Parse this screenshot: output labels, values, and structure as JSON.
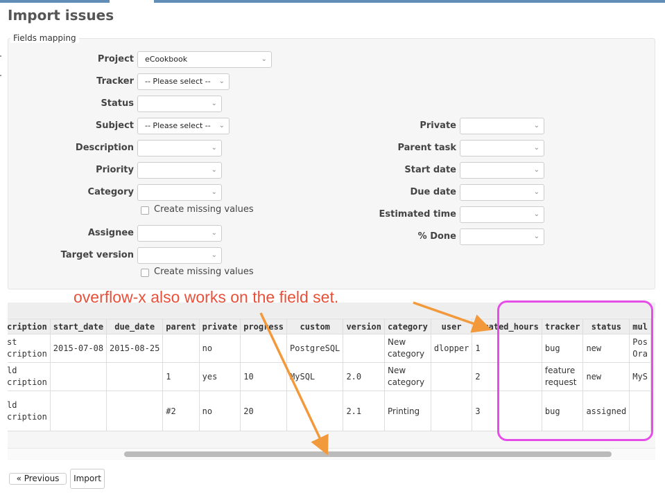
{
  "page": {
    "title": "Import issues"
  },
  "fieldset": {
    "legend": "Fields mapping"
  },
  "left_fields": [
    {
      "label": "Project",
      "value": "eCookbook"
    },
    {
      "label": "Tracker",
      "value": "-- Please select --"
    },
    {
      "label": "Status",
      "value": ""
    },
    {
      "label": "Subject",
      "value": "-- Please select --"
    },
    {
      "label": "Description",
      "value": ""
    },
    {
      "label": "Priority",
      "value": ""
    },
    {
      "label": "Category",
      "value": ""
    },
    {
      "label": "Assignee",
      "value": ""
    },
    {
      "label": "Target version",
      "value": ""
    }
  ],
  "create_missing_label": "Create missing values",
  "right_fields": [
    {
      "label": "Private",
      "value": ""
    },
    {
      "label": "Parent task",
      "value": ""
    },
    {
      "label": "Start date",
      "value": ""
    },
    {
      "label": "Due date",
      "value": ""
    },
    {
      "label": "Estimated time",
      "value": ""
    },
    {
      "label": "% Done",
      "value": ""
    }
  ],
  "preview_table": {
    "headers": [
      "cription",
      "start_date",
      "due_date",
      "parent",
      "private",
      "progress",
      "custom",
      "version",
      "category",
      "user",
      "imated_hours",
      "tracker",
      "status",
      "mul"
    ],
    "rows": [
      [
        "st\ncription",
        "2015-07-08",
        "2015-08-25",
        "",
        "no",
        "",
        "PostgreSQL",
        "",
        "New\ncategory",
        "dlopper",
        "1",
        "",
        "bug",
        "new",
        "Pos\nOra"
      ],
      [
        "ld\ncription",
        "",
        "",
        "1",
        "yes",
        "10",
        "MySQL",
        "2.0",
        "New\ncategory",
        "",
        "2",
        "",
        "feature\nrequest",
        "new",
        "MyS"
      ],
      [
        "ld\ncription",
        "",
        "",
        "#2",
        "no",
        "20",
        "",
        "2.1",
        "Printing",
        "",
        "3",
        "",
        "bug",
        "assigned",
        ""
      ]
    ]
  },
  "buttons": {
    "previous": "« Previous",
    "import": "Import"
  },
  "annotation": {
    "text": "overflow-x also works on the field set."
  },
  "colors": {
    "annotation_text": "#e8503a",
    "annotation_box": "#e64de8",
    "arrow": "#f29a3b",
    "topbar": "#628db6"
  },
  "icons": {
    "select_chevron": "chevron-down-icon"
  }
}
